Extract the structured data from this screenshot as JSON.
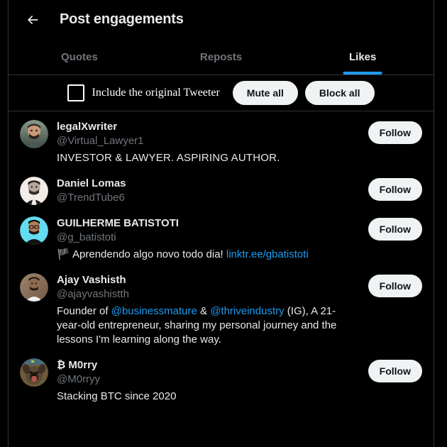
{
  "header": {
    "back_icon": "arrow-left-icon",
    "title": "Post engagements"
  },
  "tabs": [
    {
      "label": "Quotes",
      "active": false
    },
    {
      "label": "Reposts",
      "active": false
    },
    {
      "label": "Likes",
      "active": true
    }
  ],
  "action_bar": {
    "checkbox_checked": false,
    "checkbox_label": "Include the original Tweeter",
    "mute_all_label": "Mute all",
    "block_all_label": "Block all"
  },
  "colors": {
    "background": "#000000",
    "text_primary": "#e7e9ea",
    "text_secondary": "#71767b",
    "accent": "#1d9bf0",
    "border": "#2f3336",
    "button_bg": "#eff3f4",
    "button_text": "#0f1419"
  },
  "users": [
    {
      "name": "legalXwriter",
      "handle": "@Virtual_Lawyer1",
      "bio": "INVESTOR & LAWYER. ASPIRING AUTHOR.",
      "bio_style": "smallcaps",
      "follow_label": "Follow",
      "avatar": "avatar-legalxwriter"
    },
    {
      "name": "Daniel Lomas",
      "handle": "@TrendTube6",
      "bio": "",
      "bio_style": "none",
      "follow_label": "Follow",
      "avatar": "avatar-daniel-lomas"
    },
    {
      "name": "GUILHERME BATISTOTI",
      "handle": "@g_batistoti",
      "bio_flag": "🏴",
      "bio_pre": " Aprendendo algo novo todo dia! ",
      "bio_link": "linktr.ee/gbatistoti",
      "bio_style": "flag-link",
      "follow_label": "Follow",
      "avatar": "avatar-guilherme-batistoti"
    },
    {
      "name": "Ajay Vashisth",
      "handle": "@ajayvashistth",
      "bio_pre": "Founder of ",
      "bio_mention1": "@businessmature",
      "bio_mid": " & ",
      "bio_mention2": "@thriveindustry",
      "bio_post": " (IG), A 21-year-old entrepreneur, sharing my personal journey and the lessons I'm learning along the way.",
      "bio_style": "mentions",
      "follow_label": "Follow",
      "avatar": "avatar-ajay-vashisth"
    },
    {
      "name": "₿ M0rry",
      "handle": "@M0rryy",
      "bio": "Stacking BTC since 2020",
      "bio_style": "plain",
      "follow_label": "Follow",
      "avatar": "avatar-b-morry"
    }
  ]
}
